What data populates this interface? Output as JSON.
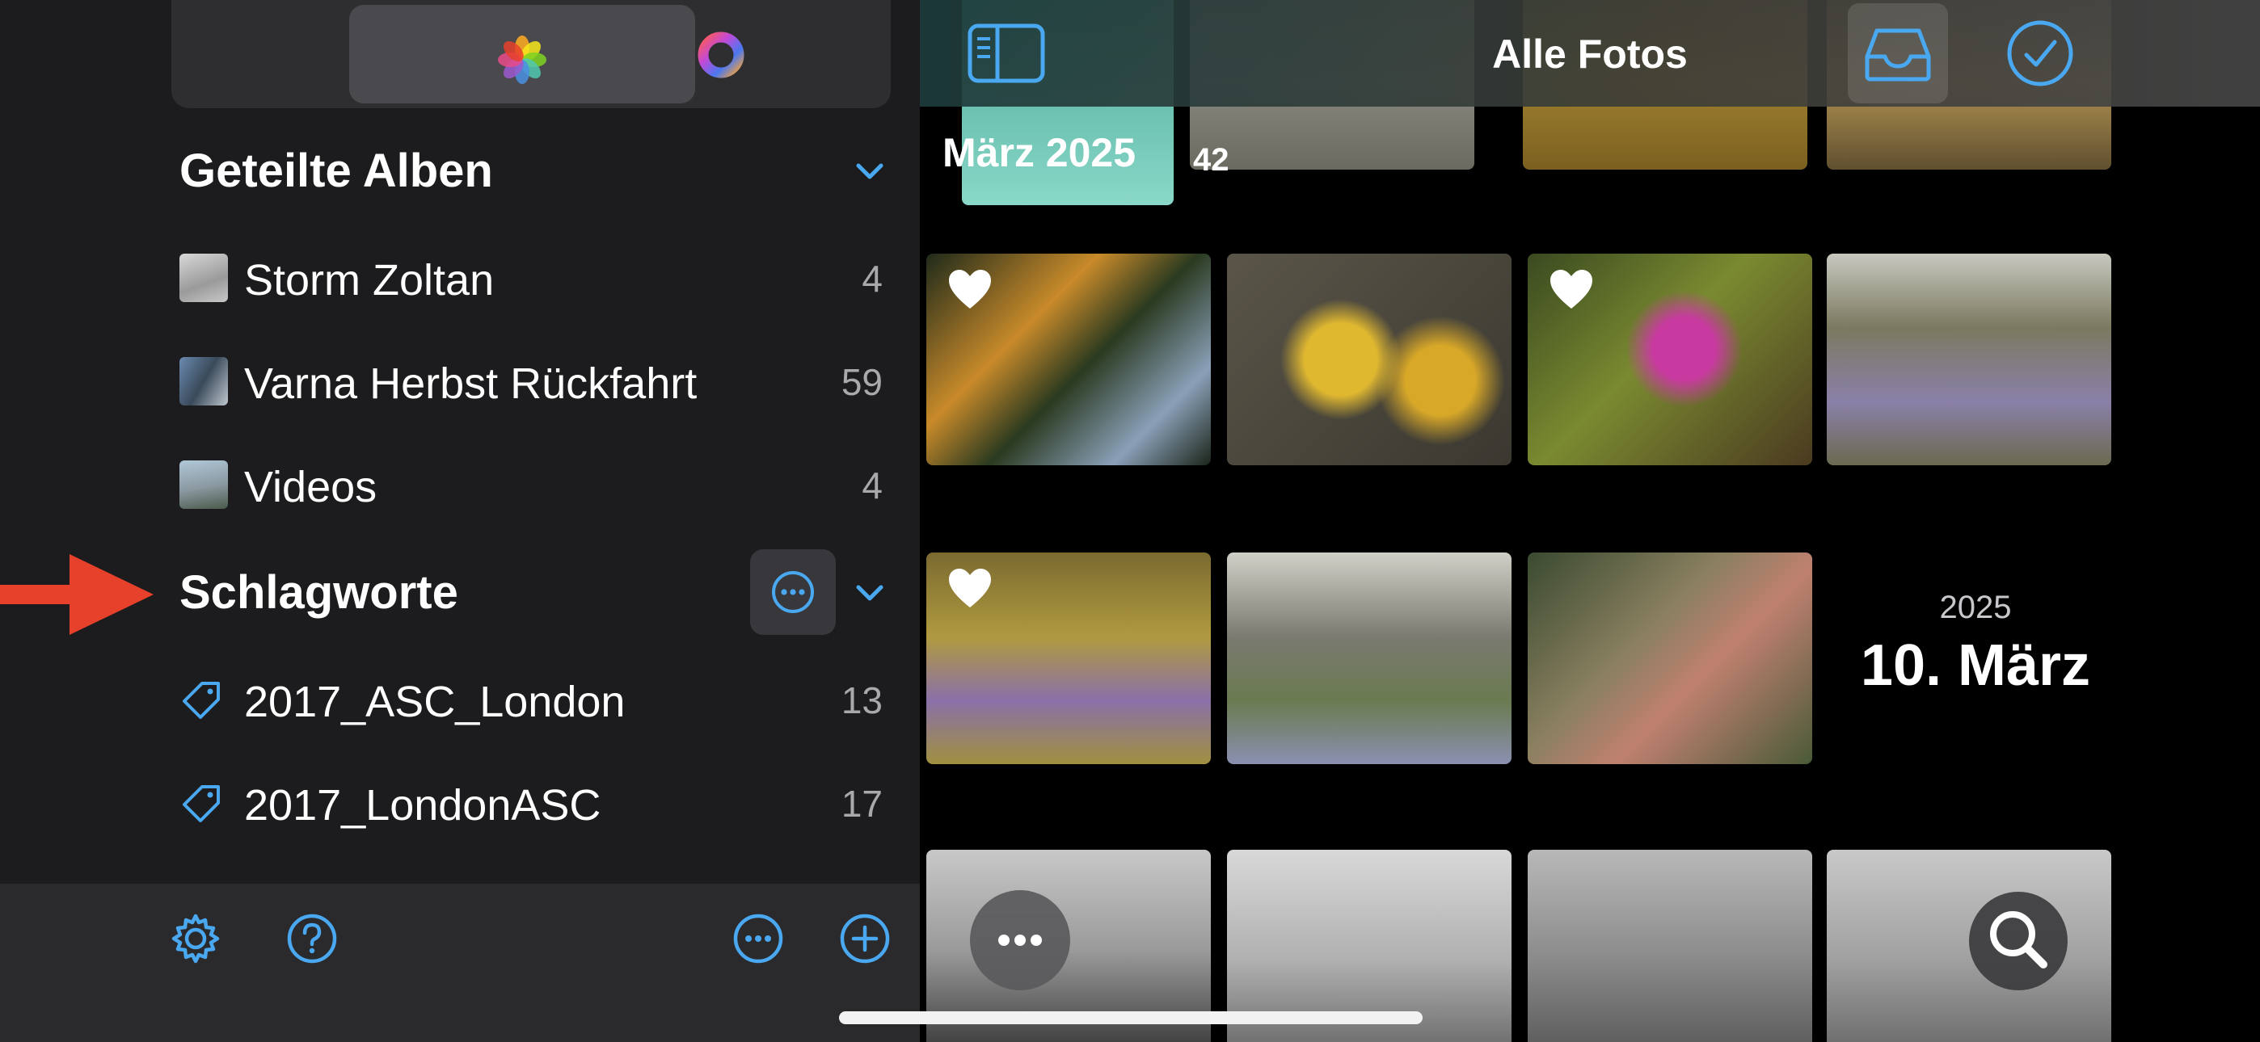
{
  "sidebar": {
    "sections": {
      "shared_albums": {
        "title": "Geteilte Alben",
        "items": [
          {
            "label": "Storm Zoltan",
            "count": "4"
          },
          {
            "label": "Varna Herbst Rückfahrt",
            "count": "59"
          },
          {
            "label": "Videos",
            "count": "4"
          }
        ]
      },
      "keywords": {
        "title": "Schlagworte",
        "items": [
          {
            "label": "2017_ASC_London",
            "count": "13"
          },
          {
            "label": "2017_LondonASC",
            "count": "17"
          }
        ]
      }
    },
    "footer_icons": [
      "settings-gear-icon",
      "help-icon",
      "more-icon",
      "add-icon"
    ]
  },
  "main": {
    "title": "Alle Fotos",
    "month_label": "März 2025",
    "month_count": "42",
    "date_year": "2025",
    "date_day": "10. März"
  },
  "colors": {
    "accent": "#4aa8f0",
    "arrow": "#e8412b",
    "sidebar_bg": "#1c1c1e",
    "secondary_text": "#a8a8ad"
  }
}
